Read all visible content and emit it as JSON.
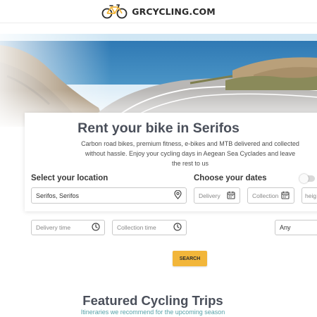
{
  "header": {
    "logo_text": "GRCYCLING.COM",
    "logo_icon": "bicycle-icon"
  },
  "hero": {
    "image": "coastal-road-photo"
  },
  "booking": {
    "title": "Rent your bike in Serifos",
    "description": "Carbon road bikes, premium fitness, e-bikes and MTB delivered and collected without hassle. Enjoy your cycling days in Aegean Sea Cyclades and leave the rest to us",
    "location_label": "Select your location",
    "location_value": "Serifos, Serifos",
    "dates_label": "Choose your dates",
    "delivery_placeholder": "Delivery",
    "collection_placeholder": "Collection",
    "height_placeholder": "heig",
    "delivery_time_placeholder": "Delivery time",
    "collection_time_placeholder": "Collection time",
    "any_option": "Any",
    "search_label": "SEARCH"
  },
  "featured": {
    "title": "Featured Cycling Trips",
    "subtitle": "Itineraries we recommend for the upcoming season"
  },
  "colors": {
    "accent": "#f2b63a",
    "teal": "#58a2a9",
    "heading": "#4a4f5a"
  }
}
